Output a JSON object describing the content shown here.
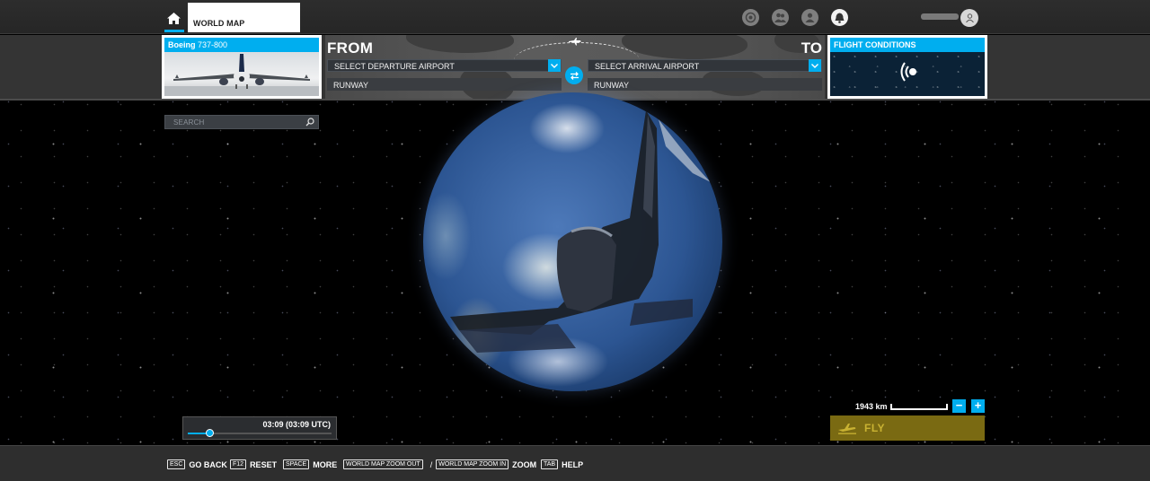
{
  "header": {
    "home_icon": "home-icon",
    "tab_label": "WORLD MAP",
    "icons": [
      "activity-icon",
      "friends-icon",
      "profile-icon",
      "notifications-icon"
    ]
  },
  "aircraft": {
    "manufacturer": "Boeing",
    "model": "737-800"
  },
  "route": {
    "from_label": "FROM",
    "to_label": "TO",
    "departure_placeholder": "SELECT DEPARTURE AIRPORT",
    "arrival_placeholder": "SELECT ARRIVAL AIRPORT",
    "departure_runway": "RUNWAY",
    "arrival_runway": "RUNWAY"
  },
  "conditions": {
    "title": "FLIGHT CONDITIONS"
  },
  "search": {
    "placeholder": "SEARCH"
  },
  "map": {
    "scale_label": "1943 km",
    "zoom_out": "−",
    "zoom_in": "+"
  },
  "time": {
    "display": "03:09 (03:09 UTC)",
    "slider_fraction": 0.15
  },
  "fly": {
    "label": "FLY"
  },
  "footer": {
    "hints": [
      {
        "key": "ESC",
        "label": "GO BACK"
      },
      {
        "key": "F12",
        "label": "RESET"
      },
      {
        "key": "SPACE",
        "label": "MORE"
      }
    ],
    "zoom_out_key": "WORLD MAP ZOOM OUT",
    "zoom_sep": "/",
    "zoom_in_key": "WORLD MAP ZOOM IN",
    "zoom_label": "ZOOM",
    "help_key": "TAB",
    "help_label": "HELP"
  },
  "colors": {
    "accent": "#00aeef",
    "fly_button": "#7a6a12",
    "background": "#000000"
  }
}
